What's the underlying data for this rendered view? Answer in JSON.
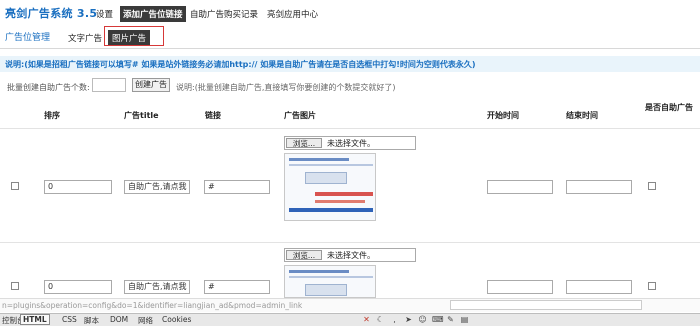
{
  "header": {
    "brand": "亮剑广告系统 3.5",
    "nav": [
      {
        "label": "设置"
      },
      {
        "label": "添加广告位链接",
        "active": true
      },
      {
        "label": "自助广告购买记录"
      },
      {
        "label": "亮剑应用中心"
      }
    ]
  },
  "subnav": {
    "title": "广告位管理",
    "tabs": [
      {
        "label": "文字广告"
      },
      {
        "label": "图片广告",
        "active": true
      }
    ]
  },
  "note": "说明:(如果是招租广告链接可以填写# 如果是站外链接务必请加http:// 如果是自助广告请在是否自选框中打勾!时间为空则代表永久)",
  "batch": {
    "label": "批量创建自助广告个数:",
    "input_value": "",
    "button_label": "创建广告",
    "hint": "说明:(批量创建自助广告,直接填写你要创建的个数提交就好了)"
  },
  "table": {
    "columns": [
      "排序",
      "广告title",
      "链接",
      "广告图片",
      "开始时间",
      "结束时间",
      "是否自助广告"
    ],
    "rows": [
      {
        "order": "0",
        "title": "自助广告,请点我",
        "link": "#",
        "file_button": "浏览...",
        "file_status": "未选择文件。",
        "start": "",
        "end": ""
      },
      {
        "order": "0",
        "title": "自助广告,请点我",
        "link": "#",
        "file_button": "浏览...",
        "file_status": "未选择文件。",
        "start": "",
        "end": ""
      }
    ]
  },
  "statusbar": {
    "url": "n=plugins&operation=config&do=1&identifier=liangjian_ad&pmod=admin_link"
  },
  "devtools": {
    "tabs": [
      "控制台",
      "HTML",
      "CSS",
      "脚本",
      "DOM",
      "网络",
      "Cookies"
    ],
    "active": "HTML"
  },
  "colors": {
    "brand": "#1a6fc0",
    "note_bg": "#e9f4fb",
    "nav_active_bg": "#3a3a3a",
    "highlight": "#d63838"
  },
  "icons": [
    "red-x-icon",
    "moon-icon",
    "comma-icon",
    "cursor-icon",
    "user-icon",
    "keyboard-icon",
    "tools-icon",
    "chart-icon"
  ]
}
